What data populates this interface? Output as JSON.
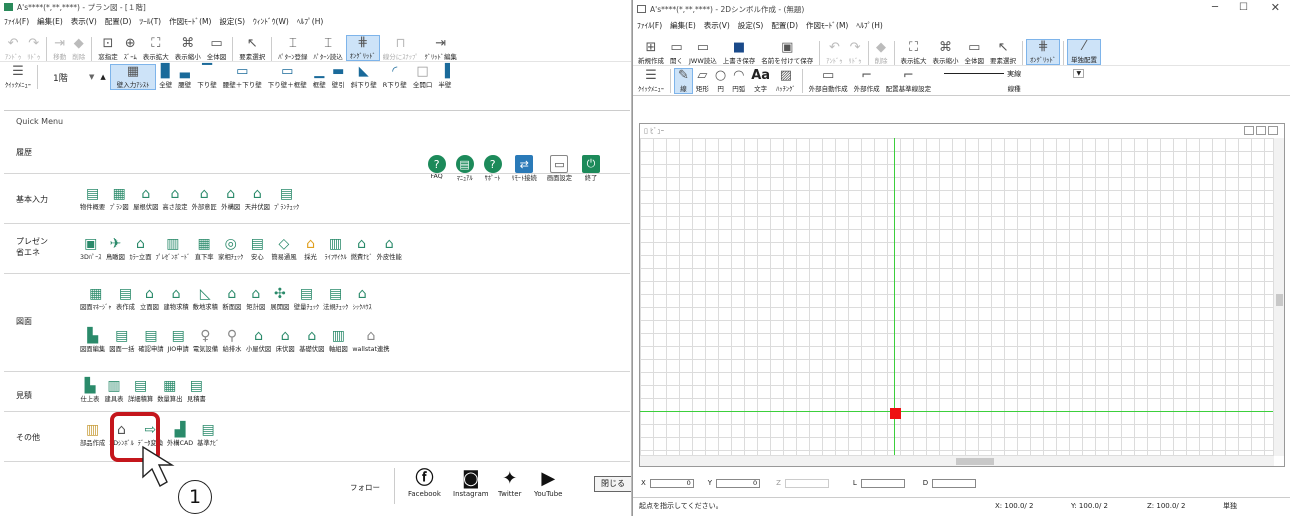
{
  "w1": {
    "title": "A's****(*,**,****) - プラン図 - [１階]",
    "menus": [
      "ﾌｧｲﾙ(F)",
      "編集(E)",
      "表示(V)",
      "配置(D)",
      "ﾂｰﾙ(T)",
      "作図ﾓｰﾄﾞ(M)",
      "設定(S)",
      "ｳｨﾝﾄﾞｳ(W)",
      "ﾍﾙﾌﾟ(H)"
    ],
    "toolbar1": [
      "ｱﾝﾄﾞｩ",
      "ﾘﾄﾞｩ",
      "移動",
      "削除",
      "窓指定",
      "ｽﾞｰﾑ",
      "表示拡大",
      "表示縮小",
      "全体図",
      "要素選択",
      "ﾊﾟﾀｰﾝ登録",
      "ﾊﾟﾀｰﾝ読込",
      "ｵﾝｸﾞﾘｯﾄﾞ",
      "線分にｽﾅｯﾌﾟ",
      "ｸﾞﾘｯﾄﾞ編集"
    ],
    "toolbar2": {
      "quickmenu": "ｸｲｯｸﾒﾆｭｰ",
      "floor": "1階",
      "assist": "壁入力ｱｼｽﾄ",
      "items": [
        "全壁",
        "腰壁",
        "下り壁",
        "腰壁＋下り壁",
        "下り壁＋框壁",
        "框壁",
        "壁引",
        "斜下り壁",
        "R下り壁",
        "全開口",
        "半壁"
      ]
    },
    "quickmenu": {
      "title": "Quick Menu",
      "history": {
        "label": "履歴",
        "items": [
          "FAQ",
          "ﾏﾆｭｱﾙ",
          "ｻﾎﾟｰﾄ",
          "ﾘﾓｰﾄ接続",
          "画面設定",
          "終了"
        ]
      },
      "basic": {
        "label": "基本入力",
        "items": [
          "物件概要",
          "ﾌﾟﾗﾝ図",
          "屋根伏図",
          "高さ設定",
          "外部意匠",
          "外構図",
          "天井伏図",
          "ﾌﾟﾗﾝﾁｪｯｸ"
        ]
      },
      "present": {
        "label": "プレゼン\n省エネ",
        "items": [
          "3Dﾊﾟｰｽ",
          "鳥瞰図",
          "ｶﾗｰ立面",
          "ﾌﾟﾚｾﾞﾝﾎﾞｰﾄﾞ",
          "直下率",
          "家相ﾁｪｯｸ",
          "安心",
          "簡易通風",
          "採光",
          "ﾗｲﾌｻｲｸﾙ",
          "燃費ﾅﾋﾞ",
          "外皮性能"
        ]
      },
      "drawing": {
        "label": "図面",
        "items1": [
          "図面ﾏﾈｰｼﾞｬ",
          "表作成",
          "立面図",
          "建物求積",
          "敷地求積",
          "断面図",
          "矩計図",
          "展開図",
          "壁量ﾁｪｯｸ",
          "法規ﾁｪｯｸ",
          "ｼｯｸﾊｳｽ"
        ],
        "items2": [
          "図面編集",
          "図面一括",
          "確認申請",
          "JIO申請",
          "電気設備",
          "給排水",
          "小屋伏図",
          "床伏図",
          "基礎伏図",
          "軸組図",
          "wallstat連携"
        ]
      },
      "estimate": {
        "label": "見積",
        "items": [
          "仕上表",
          "建具表",
          "詳細積算",
          "数量算出",
          "見積書"
        ]
      },
      "other": {
        "label": "その他",
        "items": [
          "部品作成",
          "2Dｼﾝﾎﾞﾙ",
          "ﾃﾞｰﾀ変換",
          "外構CAD",
          "基準ﾅﾋﾞ"
        ]
      },
      "follow": "フォロー",
      "social": [
        "Facebook",
        "Instagram",
        "Twitter",
        "YouTube"
      ],
      "close": "閉じる"
    },
    "callout": "1"
  },
  "w2": {
    "title": "A's****(*,**,****) - 2Dシンボル作成 - (無題)",
    "menus": [
      "ﾌｧｲﾙ(F)",
      "編集(E)",
      "表示(V)",
      "設定(S)",
      "配置(D)",
      "作図ﾓｰﾄﾞ(M)",
      "ﾍﾙﾌﾟ(H)"
    ],
    "toolbar1": [
      "新規作成",
      "開く",
      "JWW読込",
      "上書き保存",
      "名前を付けて保存",
      "ｱﾝﾄﾞｩ",
      "ﾘﾄﾞｩ",
      "削除",
      "表示拡大",
      "表示縮小",
      "全体図",
      "要素選択",
      "ｵﾝｸﾞﾘｯﾄﾞ",
      "単独配置"
    ],
    "toolbar2": [
      "ｸｲｯｸﾒﾆｭｰ",
      "線",
      "矩形",
      "円",
      "円弧",
      "文字",
      "ﾊｯﾁﾝｸﾞ",
      "外部自動作成",
      "外部作成",
      "配置基準線設定"
    ],
    "linetype": "実線",
    "linelabel": "線種",
    "view": "ﾋﾞｭｰ",
    "coords": {
      "x_label": "X",
      "x": "0",
      "y_label": "Y",
      "y": "0",
      "z_label": "Z",
      "l_label": "L",
      "d_label": "D"
    },
    "status": {
      "msg": "起点を指示してください。",
      "x": "X: 100.0/ 2",
      "y": "Y: 100.0/ 2",
      "z": "Z: 100.0/ 2",
      "mode": "単独"
    }
  },
  "colors": {
    "highlight": "#c4161c",
    "axis": "#3ccf3c",
    "point": "#ee1111",
    "accent": "#1c8a5a"
  }
}
